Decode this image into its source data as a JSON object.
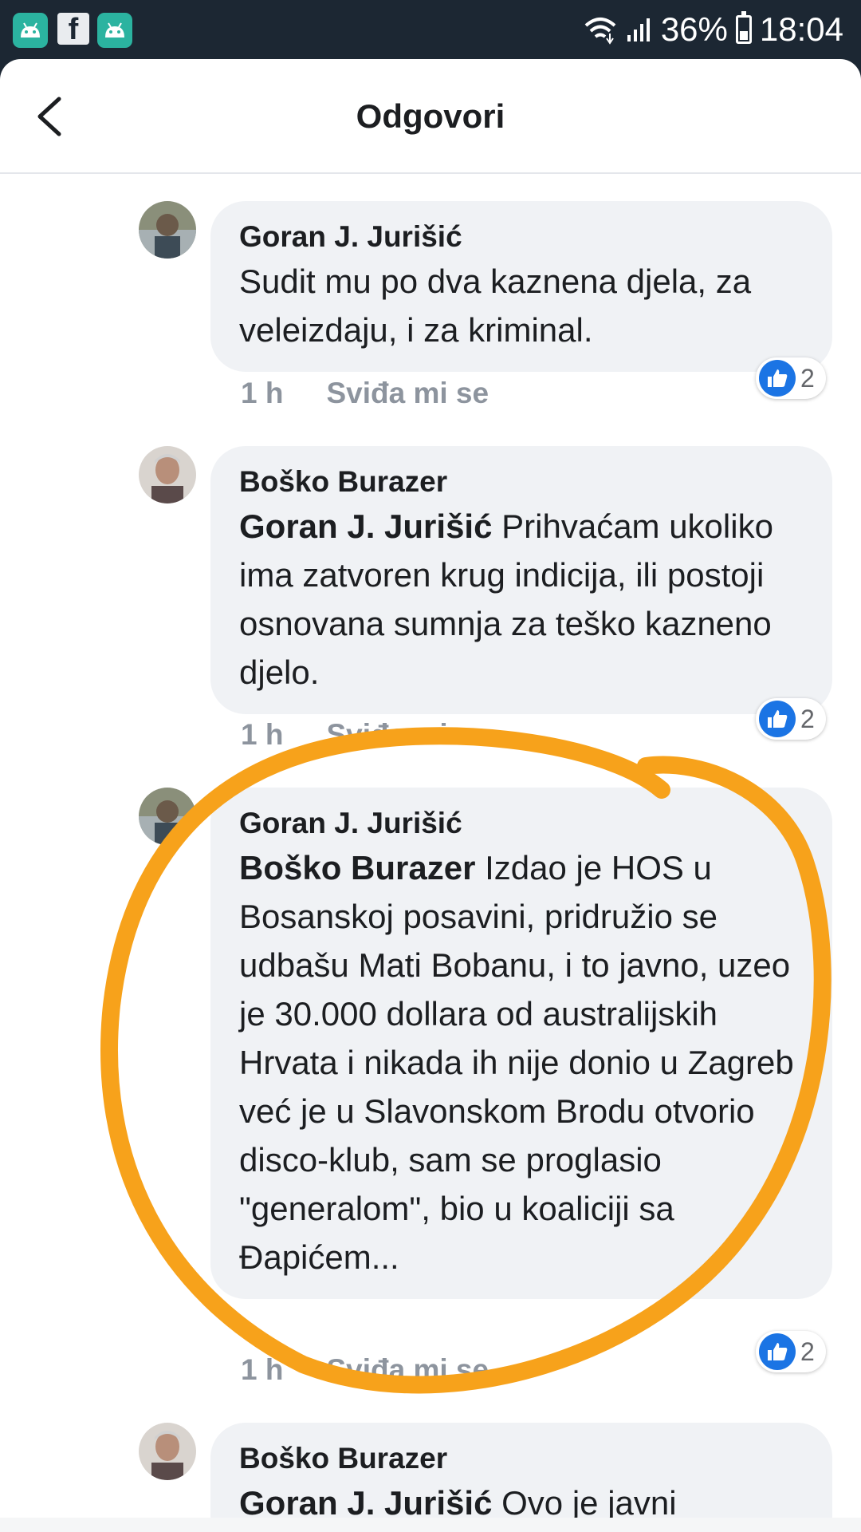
{
  "status_bar": {
    "app_icons": [
      "android-app-icon",
      "facebook-icon",
      "android-app-icon"
    ],
    "battery": "36%",
    "time": "18:04",
    "battery_level": 0.36
  },
  "header": {
    "title": "Odgovori"
  },
  "comments": [
    {
      "author": "Goran J. Jurišić",
      "mention": "",
      "text": "Sudit mu po dva kaznena djela, za veleizdaju, i za kriminal.",
      "time": "1 h",
      "like_label": "Sviđa mi se",
      "reaction_count": "2"
    },
    {
      "author": "Boško Burazer",
      "mention": "Goran J. Jurišić",
      "text": "Prihvaćam ukoliko ima zatvoren krug indicija, ili postoji osnovana sumnja za teško kazneno djelo.",
      "time": "1 h",
      "like_label": "Sviđa mi se",
      "reaction_count": "2"
    },
    {
      "author": "Goran J. Jurišić",
      "mention": "Boško Burazer",
      "text": "Izdao je HOS u Bosanskoj posavini, pridružio se udbašu Mati Bobanu, i to javno, uzeo je 30.000 dollara od australijskih Hrvata i nikada ih nije donio u Zagreb već je u Slavonskom Brodu otvorio disco-klub, sam se proglasio \"generalom\", bio u koaliciji sa Đapićem...",
      "time": "1 h",
      "like_label": "Sviđa mi se",
      "reaction_count": "2"
    },
    {
      "author": "Boško Burazer",
      "mention": "Goran J. Jurišić",
      "text": "Ovo je javni",
      "time": "",
      "like_label": "",
      "reaction_count": ""
    }
  ],
  "colors": {
    "status_bar": "#1c2733",
    "bubble": "#f0f2f5",
    "like_blue": "#1b74e4",
    "annotation_orange": "#f7a21b"
  }
}
